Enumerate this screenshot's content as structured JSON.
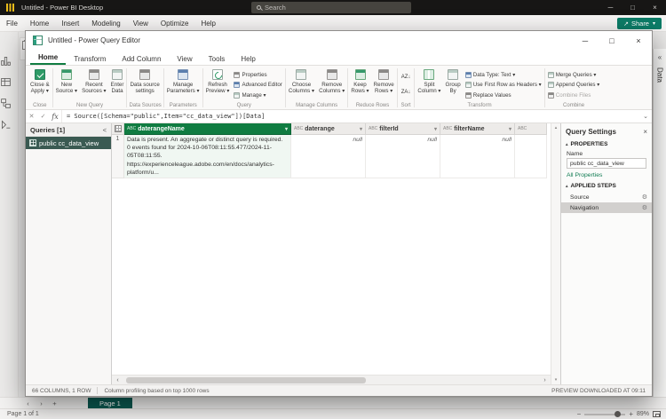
{
  "colors": {
    "titlebar_bg": "#171615",
    "share_teal": "#0C7D68",
    "selected_column_green": "#107C41",
    "selected_query_bg": "#3A5A52",
    "page_tab_teal": "#0B5A51",
    "link_green": "#0F7B52"
  },
  "icons": {
    "caret_down": "▾",
    "chevron_down": "⌄",
    "chevron_left": "‹",
    "chevron_right": "›",
    "collapse_left": "«",
    "collapse_panel": "<",
    "close": "×",
    "minimize": "─",
    "maximize": "□",
    "check": "✓",
    "cancel": "✕",
    "fx": "fx",
    "gear": "⚙",
    "section_open": "▴",
    "share_arrow": "↗",
    "plus": "+",
    "minus": "−",
    "scroll_up": "▴",
    "scroll_down": "▾",
    "sort_az": "AZ↓",
    "sort_za": "ZA↓"
  },
  "titlebar": {
    "title": "Untitled - Power BI Desktop",
    "search_placeholder": "Search"
  },
  "menubar": {
    "items": [
      "File",
      "Home",
      "Insert",
      "Modeling",
      "View",
      "Optimize",
      "Help"
    ],
    "share_label": "Share"
  },
  "data_pane_label": "Data",
  "pages": {
    "active_tab": "Page 1"
  },
  "statusbar": {
    "page_info": "Page 1 of 1",
    "zoom_level": "89%"
  },
  "pq": {
    "window_title": "Untitled - Power Query Editor",
    "tabs": [
      "Home",
      "Transform",
      "Add Column",
      "View",
      "Tools",
      "Help"
    ],
    "active_tab": "Home",
    "ribbon": {
      "groups": [
        {
          "label": "Close",
          "big": [
            [
              "Close &",
              "Apply ▾"
            ]
          ]
        },
        {
          "label": "New Query",
          "big": [
            [
              "New",
              "Source ▾"
            ],
            [
              "Recent",
              "Sources ▾"
            ],
            [
              "Enter",
              "Data"
            ]
          ]
        },
        {
          "label": "Data Sources",
          "big": [
            [
              "Data source",
              "settings"
            ]
          ]
        },
        {
          "label": "Parameters",
          "big": [
            [
              "Manage",
              "Parameters ▾"
            ]
          ]
        },
        {
          "label": "Query",
          "big": [
            [
              "Refresh",
              "Preview ▾"
            ]
          ],
          "small": [
            "Properties",
            "Advanced Editor",
            "Manage ▾"
          ]
        },
        {
          "label": "Manage Columns",
          "big": [
            [
              "Choose",
              "Columns ▾"
            ],
            [
              "Remove",
              "Columns ▾"
            ]
          ]
        },
        {
          "label": "Reduce Rows",
          "big": [
            [
              "Keep",
              "Rows ▾"
            ],
            [
              "Remove",
              "Rows ▾"
            ]
          ]
        },
        {
          "label": "Sort"
        },
        {
          "label": "Transform",
          "big": [
            [
              "Split",
              "Column ▾"
            ],
            [
              "Group",
              "By"
            ]
          ],
          "small": [
            "Data Type: Text ▾",
            "Use First Row as Headers ▾",
            "Replace Values"
          ]
        },
        {
          "label": "Combine",
          "small": [
            "Merge Queries ▾",
            "Append Queries ▾",
            "Combine Files"
          ]
        }
      ]
    },
    "formula": "= Source([Schema=\"public\",Item=\"cc_data_view\"])[Data]",
    "queries_panel": {
      "header": "Queries [1]",
      "items": [
        {
          "name": "public cc_data_view"
        }
      ]
    },
    "grid": {
      "columns": [
        {
          "type": "ABC",
          "name": "daterangeName"
        },
        {
          "type": "ABC",
          "name": "daterange"
        },
        {
          "type": "ABC",
          "name": "filterId"
        },
        {
          "type": "ABC",
          "name": "filterName"
        },
        {
          "type": "ABC",
          "name": ""
        }
      ],
      "rows": [
        {
          "num": "1",
          "daterangeName_lines": [
            "Data is present. An aggregate or distinct query is required.",
            "0 events found for 2024-10-06T08:11:55.477/2024-11-05T08:11:55.",
            "https://experienceleague.adobe.com/en/docs/analytics-platform/u..."
          ],
          "daterange": "null",
          "filterId": "null",
          "filterName": "null"
        }
      ]
    },
    "settings": {
      "title": "Query Settings",
      "properties_header": "PROPERTIES",
      "name_label": "Name",
      "name_value": "public cc_data_view",
      "all_properties_link": "All Properties",
      "applied_steps_header": "APPLIED STEPS",
      "steps": [
        {
          "name": "Source"
        },
        {
          "name": "Navigation"
        }
      ]
    },
    "status": {
      "columns_rows": "66 COLUMNS, 1 ROW",
      "profiling": "Column profiling based on top 1000 rows",
      "preview": "PREVIEW DOWNLOADED AT 09:11"
    }
  }
}
